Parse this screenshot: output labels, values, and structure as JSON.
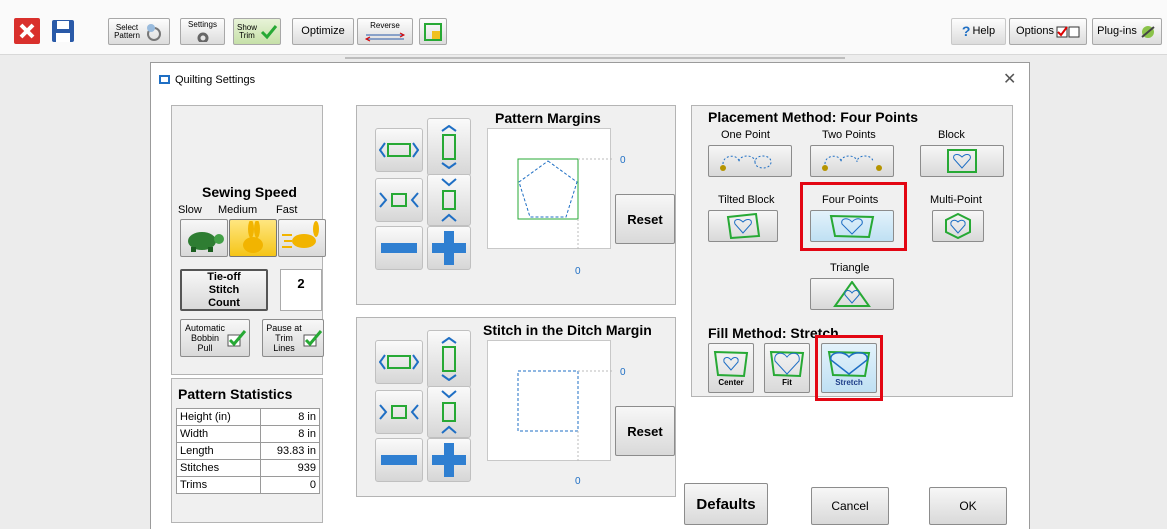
{
  "toolbar": {
    "select_pattern": "Select Pattern",
    "settings": "Settings",
    "show_trim": "Show Trim",
    "optimize": "Optimize",
    "reverse": "Reverse",
    "help": "Help",
    "options": "Options",
    "plugins": "Plug-ins"
  },
  "dialog": {
    "title": "Quilting Settings",
    "sewing_speed": {
      "title": "Sewing Speed",
      "slow": "Slow",
      "medium": "Medium",
      "fast": "Fast"
    },
    "tieoff": {
      "label": "Tie-off Stitch Count",
      "value": "2"
    },
    "auto_bobbin": "Automatic Bobbin Pull",
    "pause_trim": "Pause at Trim Lines",
    "stats": {
      "title": "Pattern Statistics",
      "rows": [
        {
          "label": "Height (in)",
          "value": "8 in"
        },
        {
          "label": "Width",
          "value": "8 in"
        },
        {
          "label": "Length",
          "value": "93.83 in"
        },
        {
          "label": "Stitches",
          "value": "939"
        },
        {
          "label": "Trims",
          "value": "0"
        }
      ]
    },
    "pattern_margins": {
      "title": "Pattern Margins",
      "right": "0",
      "bottom": "0",
      "reset": "Reset"
    },
    "ditch_margin": {
      "title": "Stitch in the Ditch Margin",
      "right": "0",
      "bottom": "0",
      "reset": "Reset"
    },
    "placement": {
      "title": "Placement Method: Four Points",
      "one_point": "One Point",
      "two_points": "Two Points",
      "block": "Block",
      "tilted_block": "Tilted Block",
      "four_points": "Four Points",
      "multi_point": "Multi-Point",
      "triangle": "Triangle"
    },
    "fill": {
      "title": "Fill Method: Stretch",
      "center": "Center",
      "fit": "Fit",
      "stretch": "Stretch"
    },
    "defaults": "Defaults",
    "cancel": "Cancel",
    "ok": "OK"
  },
  "colors": {
    "accent_green": "#27a935",
    "highlight_red": "#e30613",
    "shape_blue": "#1f6fc4"
  }
}
